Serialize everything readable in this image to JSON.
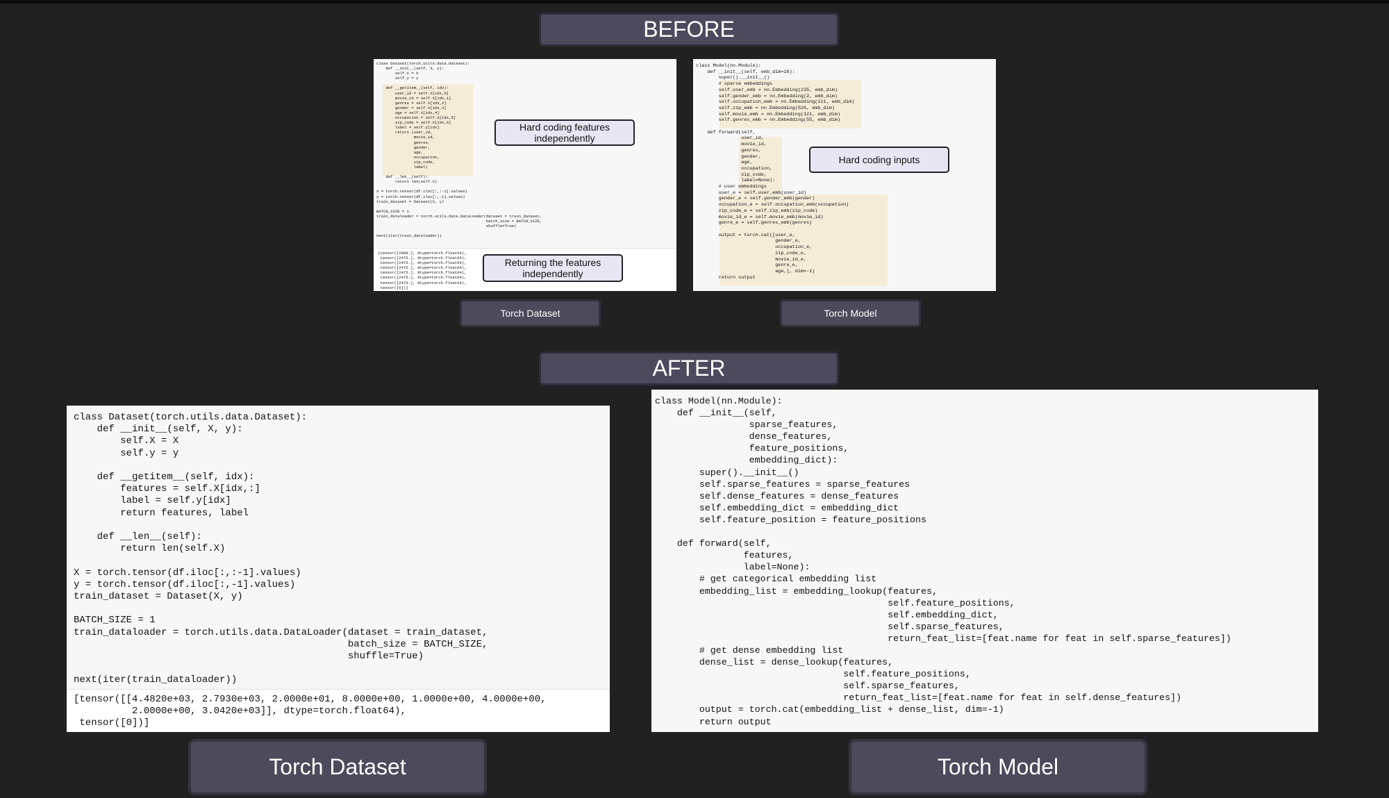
{
  "before": {
    "heading": "BEFORE",
    "dataset": {
      "code": "class Dataset(torch.utils.data.Dataset):\n    def __init__(self, X, y):\n        self.X = X\n        self.y = y\n\n    def __getitem__(self, idx):\n        user_id = self.X[idx,0]\n        movie_id = self.X[idx,1]\n        genres = self.X[idx,2]\n        gender = self.X[idx,3]\n        age = self.X[idx,4]\n        occupation = self.X[idx,5]\n        zip_code = self.X[idx,6]\n        label = self.y[idx]\n        return (user_id,\n                movie_id,\n                genres,\n                gender,\n                age,\n                occupation,\n                zip_code,\n                label)\n\n    def __len__(self):\n        return len(self.X)\n\nX = torch.tensor(df.iloc[:,:-1].values)\ny = torch.tensor(df.iloc[:,-1].values)\ntrain_dataset = Dataset(X, y)\n\nBATCH_SIZE = 1\ntrain_dataloader = torch.utils.data.DataLoader(dataset = train_dataset,\n                                               batch_size = BATCH_SIZE,\n                                               shuffle=True)\n\nnext(iter(train_dataloader))",
      "output": "[tensor([2909.], dtype=torch.float64),\n tensor([2475.], dtype=torch.float64),\n tensor([2475.], dtype=torch.float64),\n tensor([2475.], dtype=torch.float64),\n tensor([2475.], dtype=torch.float64),\n tensor([2475.], dtype=torch.float64),\n tensor([2475.], dtype=torch.float64),\n tensor([0])]",
      "callout_1": "Hard coding features independently",
      "callout_2": "Returning the features independently",
      "label": "Torch Dataset"
    },
    "model": {
      "code": "class Model(nn.Module):\n    def __init__(self, emb_dim=16):\n        super().__init__()\n        # sparse embeddings\n        self.user_emb = nn.Embedding(235, emb_dim)\n        self.gender_emb = nn.Embedding(2, emb_dim)\n        self.occupation_emb = nn.Embedding(111, emb_dim)\n        self.zip_emb = nn.Embedding(526, emb_dim)\n        self.movie_emb = nn.Embedding(121, emb_dim)\n        self.genres_emb = nn.Embedding(55, emb_dim)\n\n    def forward(self,\n                user_id,\n                movie_id,\n                genres,\n                gender,\n                age,\n                occupation,\n                zip_code,\n                label=None):\n        # user embeddings\n        user_e = self.user_emb(user_id)\n        gender_e = self.gender_emb(gender)\n        occupation_e = self.occupation_emb(occupation)\n        zip_code_e = self.zip_emb(zip_code)\n        movie_id_e = self.movie_emb(movie_id)\n        genre_e = self.genres_emb(genres)\n\n        output = torch.cat([user_e,\n                            gender_e,\n                            occupation_e,\n                            zip_code_e,\n                            movie_id_e,\n                            genre_e,\n                            age,], dim=-1)\n        return output",
      "callout": "Hard coding inputs",
      "label": "Torch Model"
    }
  },
  "after": {
    "heading": "AFTER",
    "dataset": {
      "code": "class Dataset(torch.utils.data.Dataset):\n    def __init__(self, X, y):\n        self.X = X\n        self.y = y\n\n    def __getitem__(self, idx):\n        features = self.X[idx,:]\n        label = self.y[idx]\n        return features, label\n\n    def __len__(self):\n        return len(self.X)\n\nX = torch.tensor(df.iloc[:,:-1].values)\ny = torch.tensor(df.iloc[:,-1].values)\ntrain_dataset = Dataset(X, y)\n\nBATCH_SIZE = 1\ntrain_dataloader = torch.utils.data.DataLoader(dataset = train_dataset,\n                                               batch_size = BATCH_SIZE,\n                                               shuffle=True)\n\nnext(iter(train_dataloader))",
      "output": "[tensor([[4.4820e+03, 2.7930e+03, 2.0000e+01, 8.0000e+00, 1.0000e+00, 4.0000e+00,\n          2.0000e+00, 3.0420e+03]], dtype=torch.float64),\n tensor([0])]",
      "label": "Torch Dataset"
    },
    "model": {
      "code": "class Model(nn.Module):\n    def __init__(self,\n                 sparse_features,\n                 dense_features,\n                 feature_positions,\n                 embedding_dict):\n        super().__init__()\n        self.sparse_features = sparse_features\n        self.dense_features = dense_features\n        self.embedding_dict = embedding_dict\n        self.feature_position = feature_positions\n\n    def forward(self,\n                features,\n                label=None):\n        # get categorical embedding list\n        embedding_list = embedding_lookup(features,\n                                          self.feature_positions,\n                                          self.embedding_dict,\n                                          self.sparse_features,\n                                          return_feat_list=[feat.name for feat in self.sparse_features])\n        # get dense embedding list\n        dense_list = dense_lookup(features,\n                                  self.feature_positions,\n                                  self.sparse_features,\n                                  return_feat_list=[feat.name for feat in self.dense_features])\n        output = torch.cat(embedding_list + dense_list, dim=-1)\n        return output",
      "label": "Torch Model"
    }
  }
}
